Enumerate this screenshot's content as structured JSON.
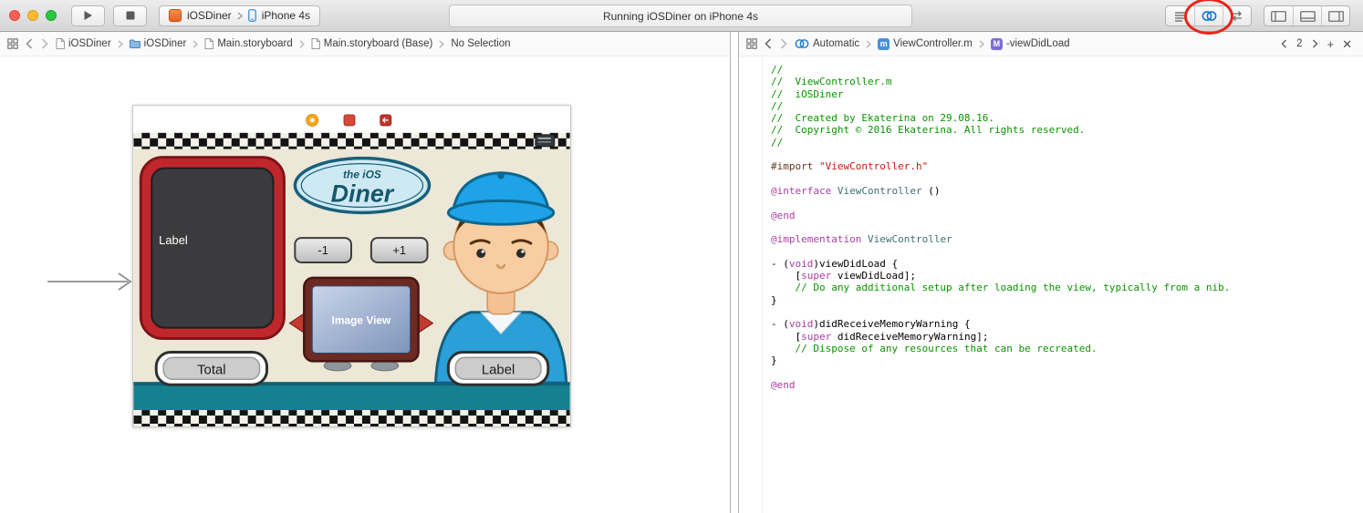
{
  "toolbar": {
    "scheme": "iOSDiner",
    "device": "iPhone 4s",
    "status": "Running iOSDiner on iPhone 4s"
  },
  "left_jumpbar": {
    "items": [
      {
        "label": "iOSDiner"
      },
      {
        "label": "iOSDiner"
      },
      {
        "label": "Main.storyboard"
      },
      {
        "label": "Main.storyboard (Base)"
      },
      {
        "label": "No Selection"
      }
    ]
  },
  "right_jumpbar": {
    "items": [
      {
        "label": "Automatic"
      },
      {
        "label": "ViewController.m"
      },
      {
        "label": "-viewDidLoad"
      }
    ],
    "counter": "2",
    "add": "+",
    "close": "✕"
  },
  "storyboard": {
    "chalkboard_text": "Label",
    "logo_top": "the iOS",
    "logo_name": "Diner",
    "minus_button": "-1",
    "plus_button": "+1",
    "image_view_label": "Image View",
    "total_label": "Total",
    "price_label": "Label"
  },
  "colors": {
    "annotation_red": "#e8251a",
    "accent_blue": "#1576d2",
    "comment_green": "#0a9400",
    "keyword_pink": "#ad3da4",
    "string_red": "#c41a16",
    "class_teal": "#3f6e74",
    "preprocessor_brown": "#643820",
    "diner_teal": "#15808f",
    "chalkboard_red": "#c0272d"
  },
  "code": {
    "lines": [
      [
        [
          "c",
          "//"
        ]
      ],
      [
        [
          "c",
          "//  ViewController.m"
        ]
      ],
      [
        [
          "c",
          "//  iOSDiner"
        ]
      ],
      [
        [
          "c",
          "//"
        ]
      ],
      [
        [
          "c",
          "//  Created by Ekaterina on 29.08.16."
        ]
      ],
      [
        [
          "c",
          "//  Copyright © 2016 Ekaterina. All rights reserved."
        ]
      ],
      [
        [
          "c",
          "//"
        ]
      ],
      [],
      [
        [
          "pre",
          "#import "
        ],
        [
          "s",
          "\"ViewController.h\""
        ]
      ],
      [],
      [
        [
          "k",
          "@interface"
        ],
        [
          "p",
          " "
        ],
        [
          "t",
          "ViewController"
        ],
        [
          "p",
          " ()"
        ]
      ],
      [],
      [
        [
          "k",
          "@end"
        ]
      ],
      [],
      [
        [
          "k",
          "@implementation"
        ],
        [
          "p",
          " "
        ],
        [
          "t",
          "ViewController"
        ]
      ],
      [],
      [
        [
          "p",
          "- ("
        ],
        [
          "k",
          "void"
        ],
        [
          "p",
          ")viewDidLoad {"
        ]
      ],
      [
        [
          "p",
          "    ["
        ],
        [
          "k",
          "super"
        ],
        [
          "p",
          " viewDidLoad];"
        ]
      ],
      [
        [
          "c",
          "    // Do any additional setup after loading the view, typically from a nib."
        ]
      ],
      [
        [
          "p",
          "}"
        ]
      ],
      [],
      [
        [
          "p",
          "- ("
        ],
        [
          "k",
          "void"
        ],
        [
          "p",
          ")didReceiveMemoryWarning {"
        ]
      ],
      [
        [
          "p",
          "    ["
        ],
        [
          "k",
          "super"
        ],
        [
          "p",
          " didReceiveMemoryWarning];"
        ]
      ],
      [
        [
          "c",
          "    // Dispose of any resources that can be recreated."
        ]
      ],
      [
        [
          "p",
          "}"
        ]
      ],
      [],
      [
        [
          "k",
          "@end"
        ]
      ]
    ]
  }
}
